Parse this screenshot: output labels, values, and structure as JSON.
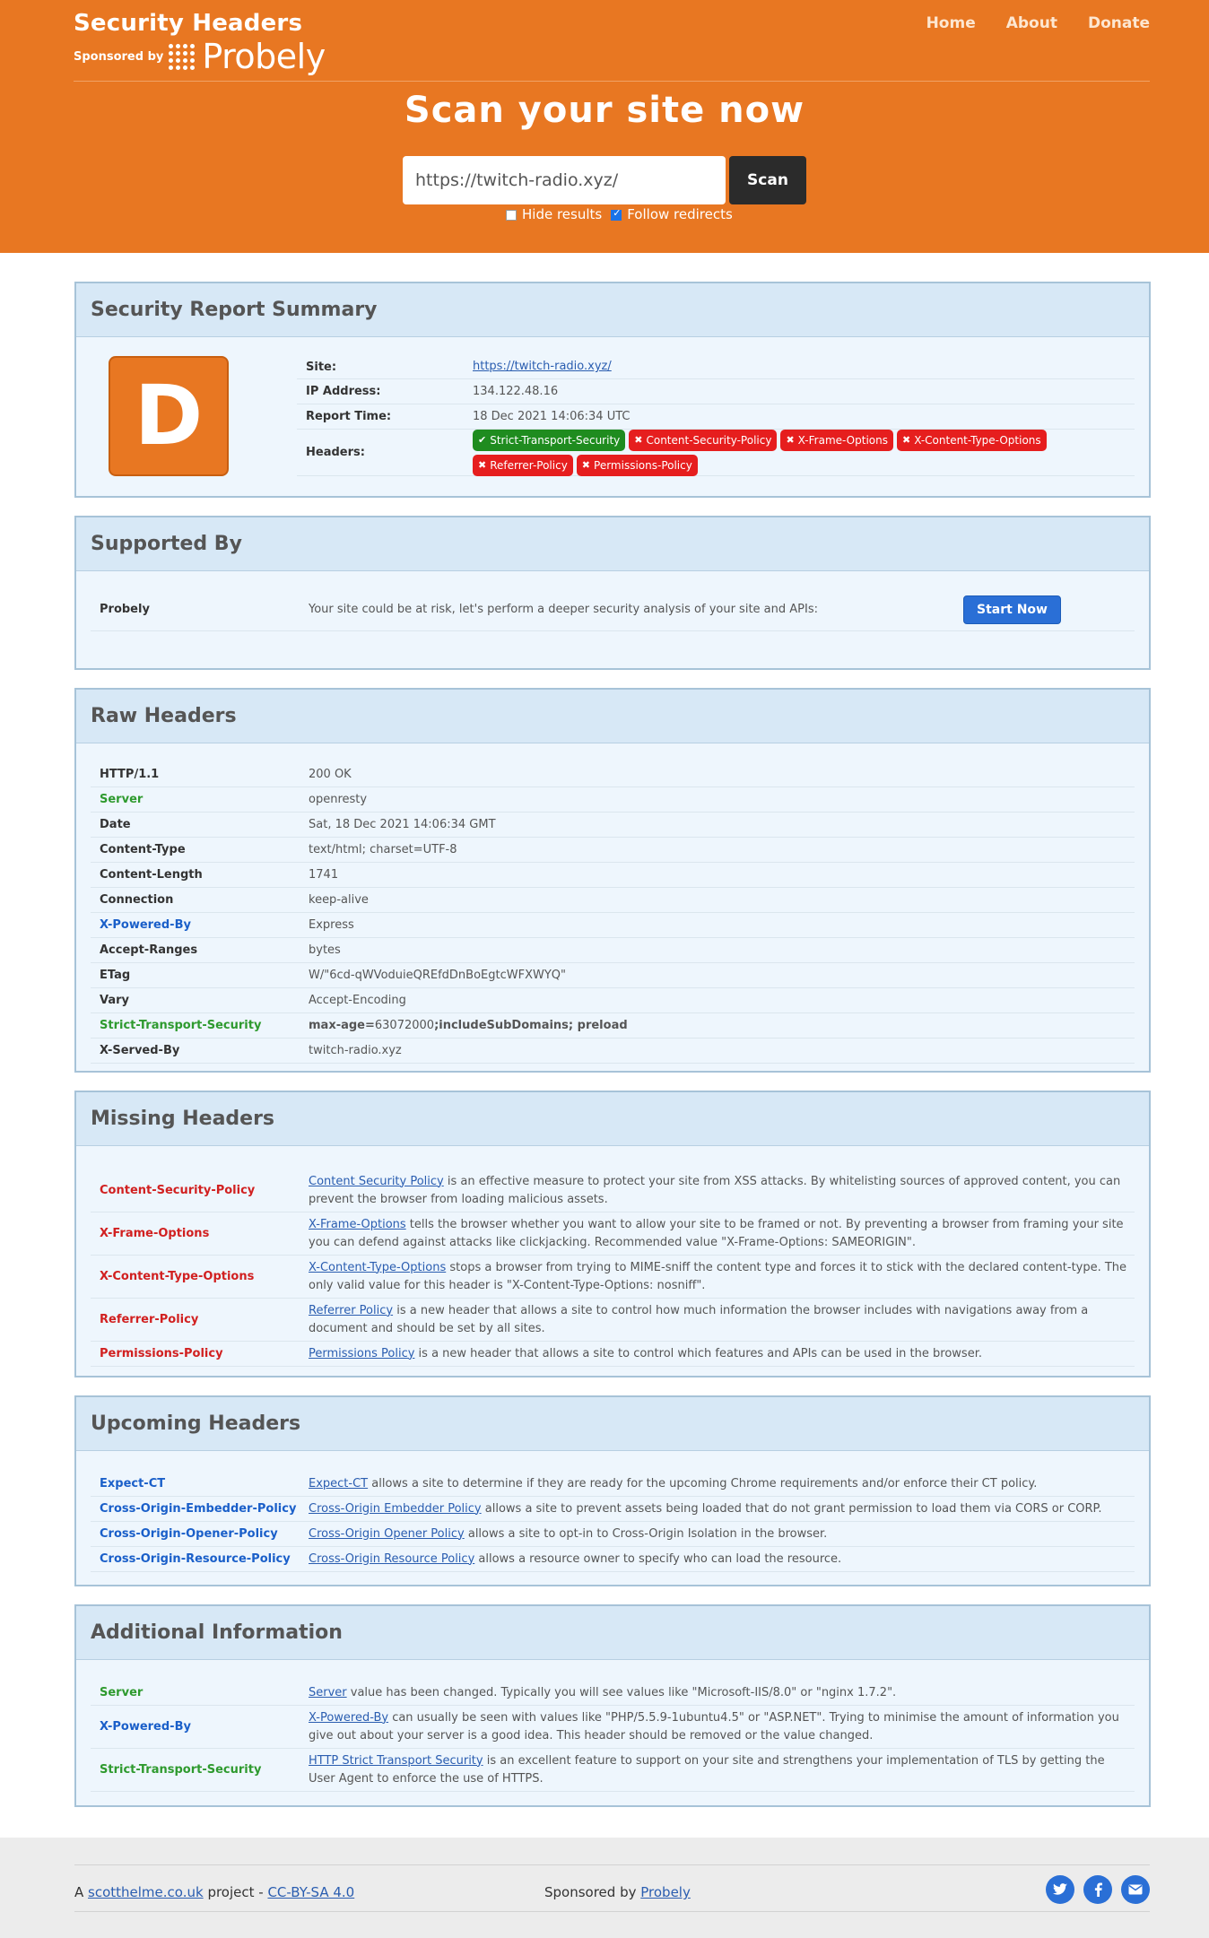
{
  "header": {
    "brand_title": "Security Headers",
    "sponsored_by": "Sponsored by",
    "sponsor_name": "Probely",
    "nav": [
      "Home",
      "About",
      "Donate"
    ],
    "hero_title": "Scan your site now",
    "scan_value": "https://twitch-radio.xyz/",
    "scan_button": "Scan",
    "hide_results": "Hide results",
    "follow_redirects": "Follow redirects",
    "hide_results_checked": false,
    "follow_redirects_checked": true
  },
  "summary": {
    "title": "Security Report Summary",
    "grade": "D",
    "grade_color": "#e87722",
    "site_label": "Site:",
    "site_value": "https://twitch-radio.xyz/",
    "ip_label": "IP Address:",
    "ip_value": "134.122.48.16",
    "time_label": "Report Time:",
    "time_value": "18 Dec 2021 14:06:34 UTC",
    "headers_label": "Headers:",
    "badges": [
      {
        "label": "Strict-Transport-Security",
        "status": "ok",
        "icon": "check-icon"
      },
      {
        "label": "Content-Security-Policy",
        "status": "bad",
        "icon": "x-icon"
      },
      {
        "label": "X-Frame-Options",
        "status": "bad",
        "icon": "x-icon"
      },
      {
        "label": "X-Content-Type-Options",
        "status": "bad",
        "icon": "x-icon"
      },
      {
        "label": "Referrer-Policy",
        "status": "bad",
        "icon": "x-icon"
      },
      {
        "label": "Permissions-Policy",
        "status": "bad",
        "icon": "x-icon"
      }
    ]
  },
  "supported": {
    "title": "Supported By",
    "name": "Probely",
    "text": "Your site could be at risk, let's perform a deeper security analysis of your site and APIs:",
    "button": "Start Now"
  },
  "raw": {
    "title": "Raw Headers",
    "rows": [
      {
        "k": "HTTP/1.1",
        "v": "200 OK",
        "c": ""
      },
      {
        "k": "Server",
        "v": "openresty",
        "c": "green"
      },
      {
        "k": "Date",
        "v": "Sat, 18 Dec 2021 14:06:34 GMT",
        "c": ""
      },
      {
        "k": "Content-Type",
        "v": "text/html; charset=UTF-8",
        "c": ""
      },
      {
        "k": "Content-Length",
        "v": "1741",
        "c": ""
      },
      {
        "k": "Connection",
        "v": "keep-alive",
        "c": ""
      },
      {
        "k": "X-Powered-By",
        "v": "Express",
        "c": "blue"
      },
      {
        "k": "Accept-Ranges",
        "v": "bytes",
        "c": ""
      },
      {
        "k": "ETag",
        "v": "W/\"6cd-qWVoduieQREfdDnBoEgtcWFXWYQ\"",
        "c": ""
      },
      {
        "k": "Vary",
        "v": "Accept-Encoding",
        "c": ""
      },
      {
        "k": "Strict-Transport-Security",
        "v_pre": "max-age=",
        "v_num": "63072000",
        "v_post": ";includeSubDomains; preload",
        "c": "green"
      },
      {
        "k": "X-Served-By",
        "v": "twitch-radio.xyz",
        "c": ""
      }
    ]
  },
  "missing": {
    "title": "Missing Headers",
    "rows": [
      {
        "k": "Content-Security-Policy",
        "link": "Content Security Policy",
        "text": " is an effective measure to protect your site from XSS attacks. By whitelisting sources of approved content, you can prevent the browser from loading malicious assets."
      },
      {
        "k": "X-Frame-Options",
        "link": "X-Frame-Options",
        "text": " tells the browser whether you want to allow your site to be framed or not. By preventing a browser from framing your site you can defend against attacks like clickjacking. Recommended value \"X-Frame-Options: SAMEORIGIN\"."
      },
      {
        "k": "X-Content-Type-Options",
        "link": "X-Content-Type-Options",
        "text": " stops a browser from trying to MIME-sniff the content type and forces it to stick with the declared content-type. The only valid value for this header is \"X-Content-Type-Options: nosniff\"."
      },
      {
        "k": "Referrer-Policy",
        "link": "Referrer Policy",
        "text": " is a new header that allows a site to control how much information the browser includes with navigations away from a document and should be set by all sites."
      },
      {
        "k": "Permissions-Policy",
        "link": "Permissions Policy",
        "text": " is a new header that allows a site to control which features and APIs can be used in the browser."
      }
    ]
  },
  "upcoming": {
    "title": "Upcoming Headers",
    "rows": [
      {
        "k": "Expect-CT",
        "link": "Expect-CT",
        "text": " allows a site to determine if they are ready for the upcoming Chrome requirements and/or enforce their CT policy."
      },
      {
        "k": "Cross-Origin-Embedder-Policy",
        "link": "Cross-Origin Embedder Policy",
        "text": " allows a site to prevent assets being loaded that do not grant permission to load them via CORS or CORP."
      },
      {
        "k": "Cross-Origin-Opener-Policy",
        "link": "Cross-Origin Opener Policy",
        "text": " allows a site to opt-in to Cross-Origin Isolation in the browser."
      },
      {
        "k": "Cross-Origin-Resource-Policy",
        "link": "Cross-Origin Resource Policy",
        "text": " allows a resource owner to specify who can load the resource."
      }
    ]
  },
  "additional": {
    "title": "Additional Information",
    "rows": [
      {
        "k": "Server",
        "c": "green",
        "link": "Server",
        "text": " value has been changed. Typically you will see values like \"Microsoft-IIS/8.0\" or \"nginx 1.7.2\"."
      },
      {
        "k": "X-Powered-By",
        "c": "blue",
        "link": "X-Powered-By",
        "text": " can usually be seen with values like \"PHP/5.5.9-1ubuntu4.5\" or \"ASP.NET\". Trying to minimise the amount of information you give out about your server is a good idea. This header should be removed or the value changed."
      },
      {
        "k": "Strict-Transport-Security",
        "c": "green",
        "link": "HTTP Strict Transport Security",
        "text": " is an excellent feature to support on your site and strengthens your implementation of TLS by getting the User Agent to enforce the use of HTTPS."
      }
    ]
  },
  "footer": {
    "prefix": "A ",
    "author_link": "scotthelme.co.uk",
    "project": " project - ",
    "license_link": "CC-BY-SA 4.0",
    "sponsored": "Sponsored by ",
    "sponsor_link": "Probely",
    "social": [
      "twitter-icon",
      "facebook-icon",
      "email-icon"
    ]
  }
}
